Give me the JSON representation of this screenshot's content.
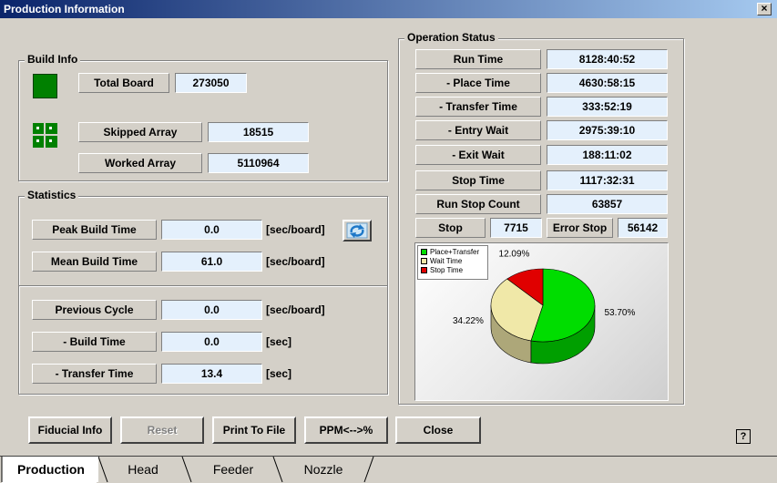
{
  "window": {
    "title": "Production Information",
    "close_label": "×"
  },
  "build_info": {
    "title": "Build Info",
    "total_board_label": "Total Board",
    "total_board_value": "273050",
    "skipped_array_label": "Skipped Array",
    "skipped_array_value": "18515",
    "worked_array_label": "Worked Array",
    "worked_array_value": "5110964"
  },
  "statistics": {
    "title": "Statistics",
    "peak_label": "Peak Build Time",
    "peak_value": "0.0",
    "peak_unit": "[sec/board]",
    "mean_label": "Mean Build Time",
    "mean_value": "61.0",
    "mean_unit": "[sec/board]",
    "prev_label": "Previous Cycle",
    "prev_value": "0.0",
    "prev_unit": "[sec/board]",
    "build_label": "- Build Time",
    "build_value": "0.0",
    "build_unit": "[sec]",
    "transfer_label": "- Transfer Time",
    "transfer_value": "13.4",
    "transfer_unit": "[sec]"
  },
  "operation_status": {
    "title": "Operation Status",
    "run_time_label": "Run Time",
    "run_time_value": "8128:40:52",
    "place_label": "- Place Time",
    "place_value": "4630:58:15",
    "transfer_label": "- Transfer Time",
    "transfer_value": "333:52:19",
    "entry_label": "- Entry Wait",
    "entry_value": "2975:39:10",
    "exit_label": "- Exit Wait",
    "exit_value": "188:11:02",
    "stop_time_label": "Stop Time",
    "stop_time_value": "1117:32:31",
    "run_stop_label": "Run Stop Count",
    "run_stop_value": "63857",
    "stop_label": "Stop",
    "stop_value": "7715",
    "error_stop_label": "Error Stop",
    "error_stop_value": "56142"
  },
  "chart_data": {
    "type": "pie",
    "categories": [
      "Place+Transfer",
      "Wait Time",
      "Stop Time"
    ],
    "values": [
      53.7,
      34.22,
      12.09
    ],
    "labels": [
      "53.70%",
      "34.22%",
      "12.09%"
    ],
    "colors": [
      "#00dd00",
      "#f0e8a8",
      "#e00000"
    ],
    "legend": "top-left"
  },
  "buttons": {
    "fiducial": "Fiducial Info",
    "reset": "Reset",
    "print": "Print To File",
    "ppm": "PPM<-->%",
    "close": "Close",
    "help": "?"
  },
  "tabs": [
    "Production",
    "Head",
    "Feeder",
    "Nozzle"
  ]
}
